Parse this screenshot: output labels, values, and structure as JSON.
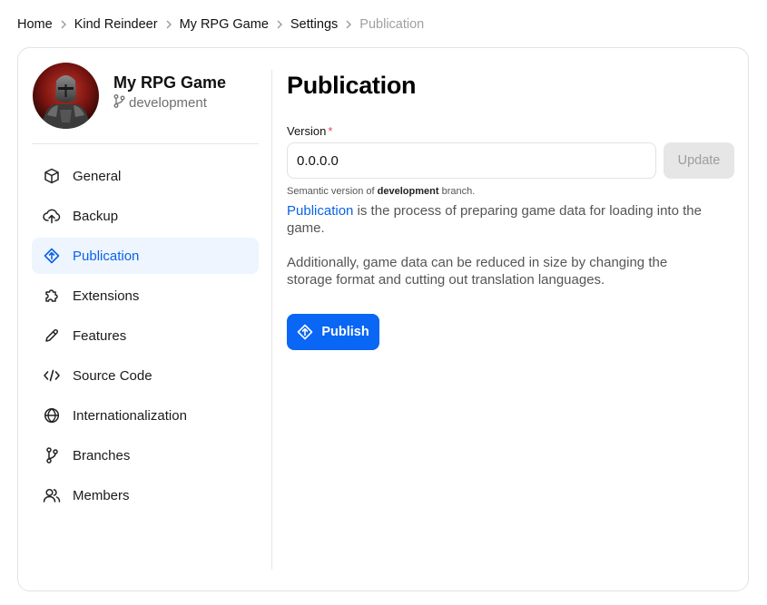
{
  "breadcrumb": {
    "items": [
      "Home",
      "Kind Reindeer",
      "My RPG Game",
      "Settings"
    ],
    "current": "Publication"
  },
  "project": {
    "name": "My RPG Game",
    "branch": "development"
  },
  "sidebar": {
    "items": [
      {
        "label": "General",
        "icon": "cube-icon"
      },
      {
        "label": "Backup",
        "icon": "cloud-upload-icon"
      },
      {
        "label": "Publication",
        "icon": "publish-diamond-icon",
        "active": true
      },
      {
        "label": "Extensions",
        "icon": "puzzle-icon"
      },
      {
        "label": "Features",
        "icon": "pencil-icon"
      },
      {
        "label": "Source Code",
        "icon": "code-icon"
      },
      {
        "label": "Internationalization",
        "icon": "globe-icon"
      },
      {
        "label": "Branches",
        "icon": "git-branch-icon"
      },
      {
        "label": "Members",
        "icon": "users-icon"
      }
    ]
  },
  "main": {
    "title": "Publication",
    "version_label": "Version",
    "required_mark": "*",
    "version_value": "0.0.0.0",
    "update_label": "Update",
    "hint_prefix": "Semantic version of",
    "hint_branch": "development",
    "hint_suffix": "branch.",
    "para1_link": "Publication",
    "para1_rest": " is the process of preparing game data for loading into the game.",
    "para2": "Additionally, game data can be reduced in size by changing the storage format and cutting out translation languages.",
    "publish_label": "Publish"
  },
  "colors": {
    "accent": "#0a66f5",
    "active_bg": "#eef5fe",
    "active_text": "#0a63e8",
    "required": "#e5484d",
    "disabled_bg": "#e6e6e6"
  }
}
